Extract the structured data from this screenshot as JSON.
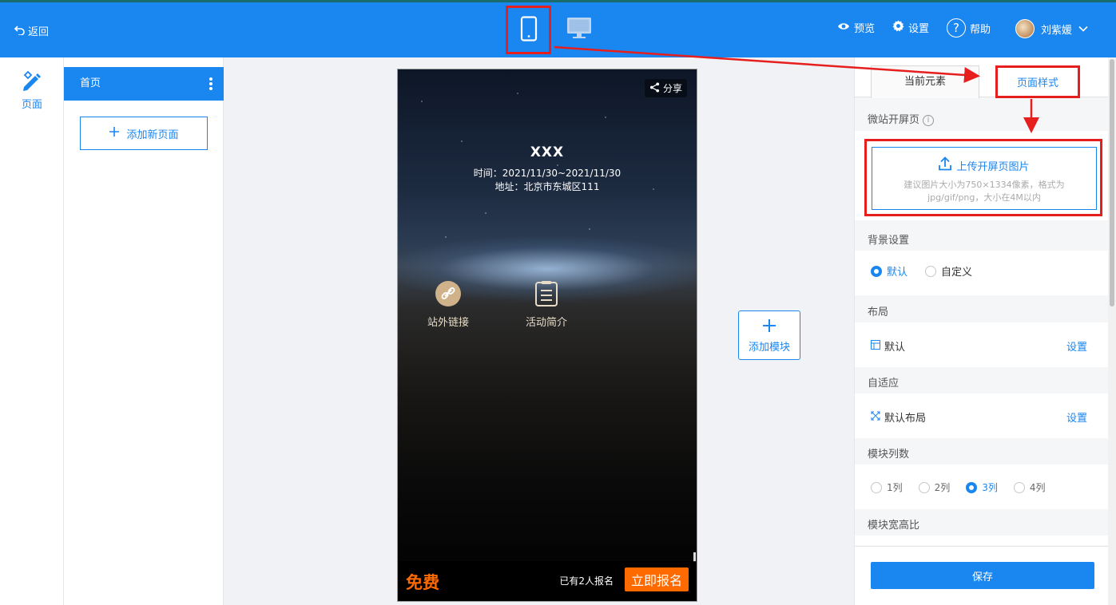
{
  "topbar": {
    "back_label": "返回",
    "preview_label": "预览",
    "settings_label": "设置",
    "help_label": "帮助",
    "user_name": "刘紫媛"
  },
  "rail": {
    "page_label": "页面"
  },
  "pages": {
    "items": [
      {
        "label": "首页"
      }
    ],
    "add_label": "添加新页面"
  },
  "phone": {
    "share_label": "分享",
    "title": "XXX",
    "time": "时间：2021/11/30~2021/11/30",
    "address": "地址：北京市东城区111",
    "modules": [
      {
        "label": "站外链接",
        "icon": "link-icon"
      },
      {
        "label": "活动简介",
        "icon": "document-icon"
      }
    ],
    "price": "免费",
    "signup_count": "已有2人报名",
    "signup_button": "立即报名"
  },
  "canvas": {
    "add_module_label": "添加模块"
  },
  "panel": {
    "tabs": [
      {
        "label": "当前元素"
      },
      {
        "label": "页面样式"
      }
    ],
    "splash_label": "微站开屏页",
    "upload_title": "上传开屏页图片",
    "upload_hint": "建议图片大小为750×1334像素，格式为jpg/gif/png，大小在4M以内",
    "background": {
      "label": "背景设置",
      "options": [
        "默认",
        "自定义"
      ],
      "selected": "默认"
    },
    "layout": {
      "label": "布局",
      "value": "默认",
      "action": "设置"
    },
    "adaptive": {
      "label": "自适应",
      "value": "默认布局",
      "action": "设置"
    },
    "columns": {
      "label": "模块列数",
      "options": [
        "1列",
        "2列",
        "3列",
        "4列"
      ],
      "selected": "3列"
    },
    "ratio_label": "模块宽高比",
    "save_label": "保存"
  },
  "colors": {
    "primary": "#1a86ef",
    "annotation": "#e61e1e",
    "accent": "#ff6a00"
  }
}
